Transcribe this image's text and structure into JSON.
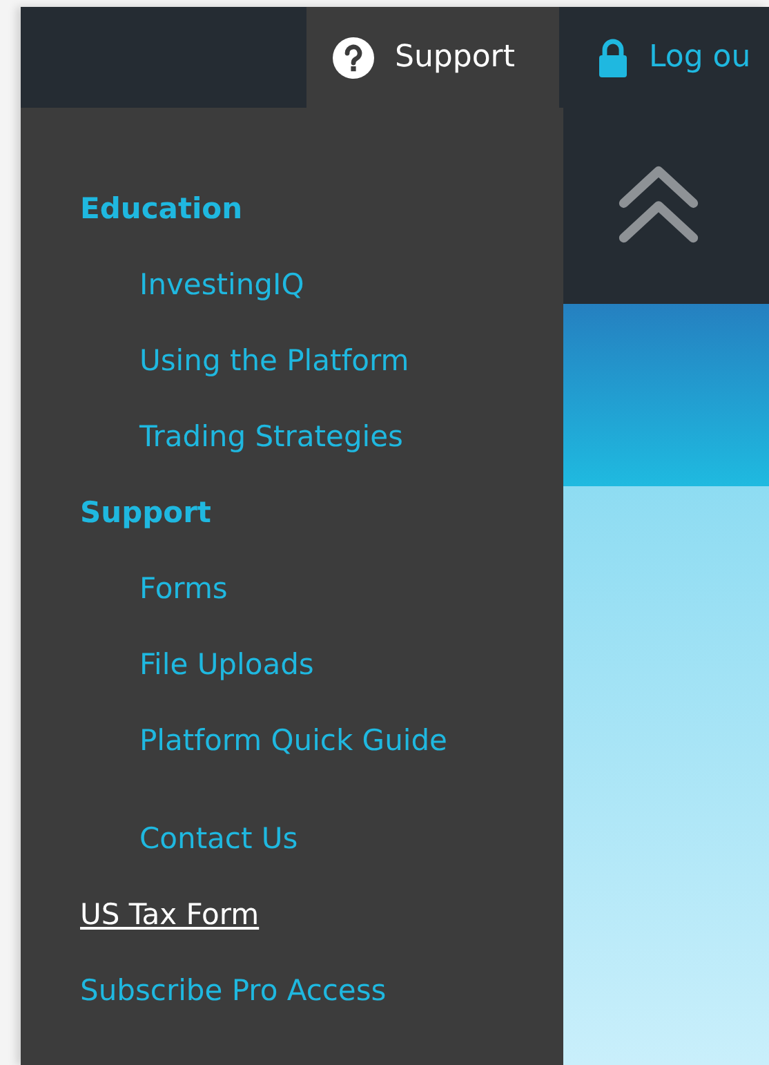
{
  "topbar": {
    "tabs": [
      {
        "label": "Support",
        "kind": "help",
        "selected": true
      },
      {
        "label": "Log ou",
        "kind": "logout",
        "selected": false
      }
    ]
  },
  "menu": {
    "groups": [
      [
        {
          "label": "Education",
          "kind": "heading",
          "selected": false
        },
        {
          "label": "InvestingIQ",
          "kind": "sub",
          "selected": false
        },
        {
          "label": "Using the Platform",
          "kind": "sub",
          "selected": false
        },
        {
          "label": "Trading Strategies",
          "kind": "sub",
          "selected": false
        },
        {
          "label": "Support",
          "kind": "heading",
          "selected": false
        },
        {
          "label": "Forms",
          "kind": "sub",
          "selected": false
        },
        {
          "label": "File Uploads",
          "kind": "sub",
          "selected": false
        },
        {
          "label": "Platform Quick Guide",
          "kind": "sub",
          "selected": false
        }
      ],
      [
        {
          "label": "Contact Us",
          "kind": "sub",
          "selected": false
        },
        {
          "label": "US Tax Form",
          "kind": "link",
          "selected": true
        },
        {
          "label": "Subscribe Pro Access",
          "kind": "link",
          "selected": false
        }
      ]
    ]
  }
}
